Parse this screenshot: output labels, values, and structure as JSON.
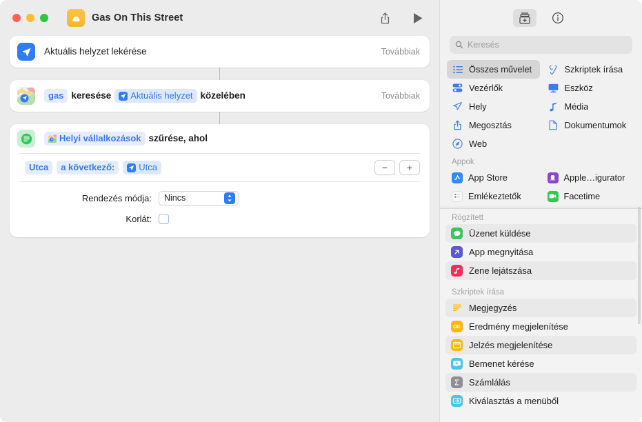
{
  "window": {
    "title": "Gas On This Street",
    "traffic_lights": [
      "close",
      "minimize",
      "zoom"
    ],
    "share_label": "share",
    "run_label": "run"
  },
  "workflow": {
    "more_label": "Továbbiak",
    "actions": [
      {
        "icon": "location-arrow-icon",
        "title": "Aktuális helyzet lekérése",
        "more": "Továbbiak"
      },
      {
        "icon": "maps-icon",
        "more": "Továbbiak",
        "tokens": [
          {
            "type": "var-blue",
            "text": "gas"
          },
          {
            "type": "plain",
            "text": "keresése"
          },
          {
            "type": "var-solid",
            "text": "Aktuális helyzet"
          },
          {
            "type": "plain",
            "text": "közelében"
          }
        ]
      }
    ],
    "filter_action": {
      "icon": "filter-icon",
      "subject_token": "Helyi vállalkozások",
      "subject_suffix": "szűrése, ahol",
      "condition": {
        "field": "Utca",
        "operator": "a következő:",
        "value": "Utca"
      },
      "stepper": {
        "minus": "−",
        "plus": "+"
      },
      "sort_label": "Rendezés módja:",
      "sort_value": "Nincs",
      "limit_label": "Korlát:",
      "limit_checked": false
    }
  },
  "sidebar": {
    "toolbar": [
      {
        "name": "action-library-icon",
        "active": true
      },
      {
        "name": "info-icon",
        "active": false
      }
    ],
    "search": {
      "placeholder": "Keresés",
      "value": ""
    },
    "categories": [
      {
        "label": "Összes művelet",
        "icon": "list-bullet-icon",
        "selected": true
      },
      {
        "label": "Szkriptek írása",
        "icon": "script-icon",
        "selected": false
      },
      {
        "label": "Vezérlők",
        "icon": "controls-icon",
        "selected": false
      },
      {
        "label": "Eszköz",
        "icon": "display-icon",
        "selected": false
      },
      {
        "label": "Hely",
        "icon": "location-arrow-icon",
        "selected": false
      },
      {
        "label": "Média",
        "icon": "music-note-icon",
        "selected": false
      },
      {
        "label": "Megosztás",
        "icon": "share-icon",
        "selected": false
      },
      {
        "label": "Dokumentumok",
        "icon": "document-icon",
        "selected": false
      },
      {
        "label": "Web",
        "icon": "safari-compass-icon",
        "selected": false
      }
    ],
    "apps_section": {
      "title": "Appok",
      "items": [
        {
          "label": "App Store",
          "icon": "app-store-icon",
          "color": "#2f8cf5"
        },
        {
          "label": "Apple…igurator",
          "icon": "apple-configurator-icon",
          "color": "#8e44d0"
        },
        {
          "label": "Emlékeztetők",
          "icon": "reminders-icon",
          "color": "#f5f5f5"
        },
        {
          "label": "Facetime",
          "icon": "facetime-icon",
          "color": "#30c94f"
        }
      ]
    },
    "pinned_section": {
      "title": "Rögzített",
      "items": [
        {
          "label": "Üzenet küldése",
          "icon": "messages-icon",
          "color": "#34c759",
          "alt": true
        },
        {
          "label": "App megnyitása",
          "icon": "open-app-icon",
          "color": "#5b57d8",
          "alt": false
        },
        {
          "label": "Zene lejátszása",
          "icon": "music-icon",
          "color": "#fa2b56",
          "alt": true
        }
      ]
    },
    "scripting_section": {
      "title": "Szkriptek írása",
      "items": [
        {
          "label": "Megjegyzés",
          "icon": "comment-icon",
          "color": "transparent",
          "alt": true
        },
        {
          "label": "Eredmény megjelenítése",
          "icon": "quicklook-icon",
          "color": "#ffb80a",
          "alt": false
        },
        {
          "label": "Jelzés megjelenítése",
          "icon": "alert-icon",
          "color": "#ffb80a",
          "alt": true
        },
        {
          "label": "Bemenet kérése",
          "icon": "ask-input-icon",
          "color": "#4cc2f7",
          "alt": false
        },
        {
          "label": "Számlálás",
          "icon": "count-icon",
          "color": "#8e8e93",
          "alt": true
        },
        {
          "label": "Kiválasztás a menüből",
          "icon": "choose-menu-icon",
          "color": "#4cc2f7",
          "alt": false
        }
      ]
    }
  },
  "colors": {
    "accent_blue": "#2f7cf6",
    "token_blue": "#3b7bf0",
    "window_bg": "#ececec",
    "sidebar_bg": "#f1f1f1"
  }
}
